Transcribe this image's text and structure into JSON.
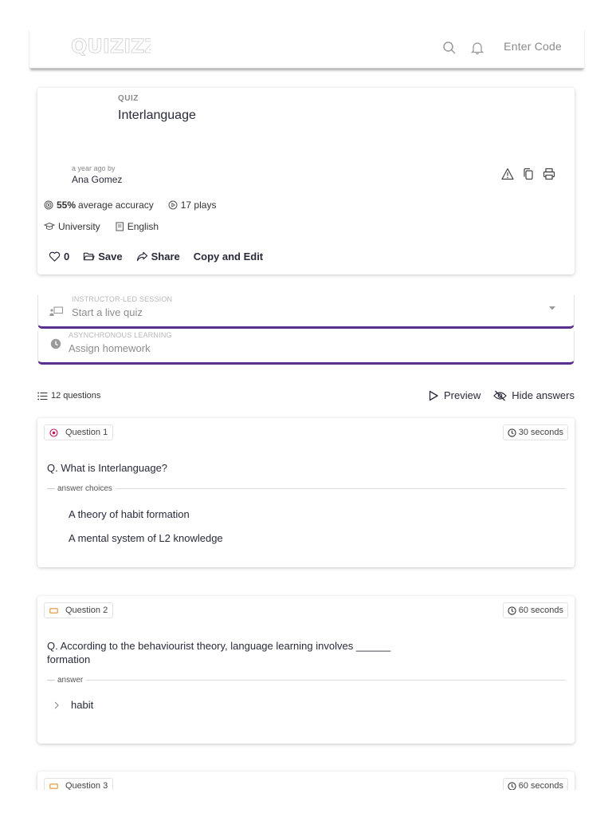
{
  "header": {
    "logo_text": "QUIZIZZ",
    "search_icon": "search-icon",
    "bell_icon": "bell-icon",
    "enter_code": "Enter Code"
  },
  "quiz": {
    "type_label": "QUIZ",
    "title": "Interlanguage",
    "time_ago": "a year ago by",
    "author": "Ana Gomez",
    "accuracy_value": "55%",
    "accuracy_label": "average accuracy",
    "plays": "17 plays",
    "grade": "University",
    "subject": "English",
    "likes": "0",
    "save_label": "Save",
    "share_label": "Share",
    "copy_edit_label": "Copy and Edit"
  },
  "sessions": [
    {
      "caption": "INSTRUCTOR-LED SESSION",
      "label": "Start a live quiz"
    },
    {
      "caption": "ASYNCHRONOUS LEARNING",
      "label": "Assign homework"
    }
  ],
  "question_list": {
    "count_label": "12 questions",
    "preview_label": "Preview",
    "hide_answers_label": "Hide answers"
  },
  "questions": [
    {
      "label": "Question 1",
      "time": "30 seconds",
      "text": "Q. What is Interlanguage?",
      "section_label": "answer choices",
      "choices": [
        "A theory of habit formation",
        "A mental system of L2 knowledge"
      ]
    },
    {
      "label": "Question 2",
      "time": "60 seconds",
      "text": "Q. According to the behaviourist theory, language learning involves ______ formation",
      "section_label": "answer",
      "answer": "habit"
    },
    {
      "label": "Question 3",
      "time": "60 seconds"
    }
  ],
  "colors": {
    "accent": "#5b2f8c",
    "multiple_choice_icon": "#c2185b",
    "fill_blank_icon": "#e0902a"
  }
}
